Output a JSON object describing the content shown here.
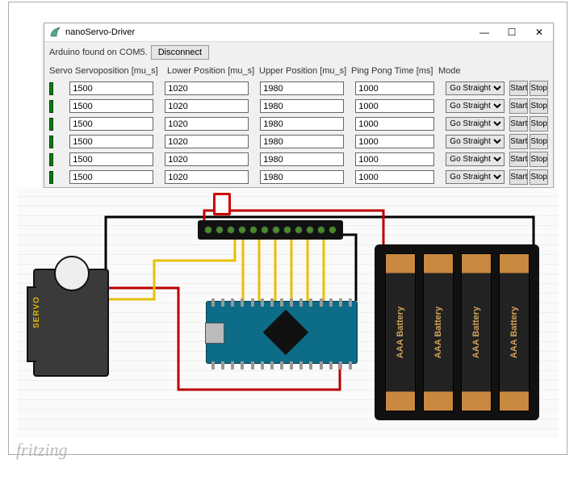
{
  "window": {
    "title": "nanoServo-Driver",
    "min": "—",
    "max": "☐",
    "close": "✕"
  },
  "status": {
    "text": "Arduino found on COM5.",
    "disconnect": "Disconnect"
  },
  "headers": {
    "servo": "Servo",
    "pos": "Servoposition [mu_s]",
    "low": "Lower Position [mu_s]",
    "up": "Upper Position [mu_s]",
    "ping": "Ping Pong Time [ms]",
    "mode": "Mode"
  },
  "mode_option": "Go Straight",
  "buttons": {
    "start": "Start",
    "stop": "Stop"
  },
  "rows": [
    {
      "pos": "1500",
      "low": "1020",
      "up": "1980",
      "ping": "1000"
    },
    {
      "pos": "1500",
      "low": "1020",
      "up": "1980",
      "ping": "1000"
    },
    {
      "pos": "1500",
      "low": "1020",
      "up": "1980",
      "ping": "1000"
    },
    {
      "pos": "1500",
      "low": "1020",
      "up": "1980",
      "ping": "1000"
    },
    {
      "pos": "1500",
      "low": "1020",
      "up": "1980",
      "ping": "1000"
    },
    {
      "pos": "1500",
      "low": "1020",
      "up": "1980",
      "ping": "1000"
    }
  ],
  "circuit": {
    "servo_label": "SERVO",
    "battery_label": "AAA Battery",
    "board": "Arduino Nano",
    "watermark": "fritzing"
  }
}
